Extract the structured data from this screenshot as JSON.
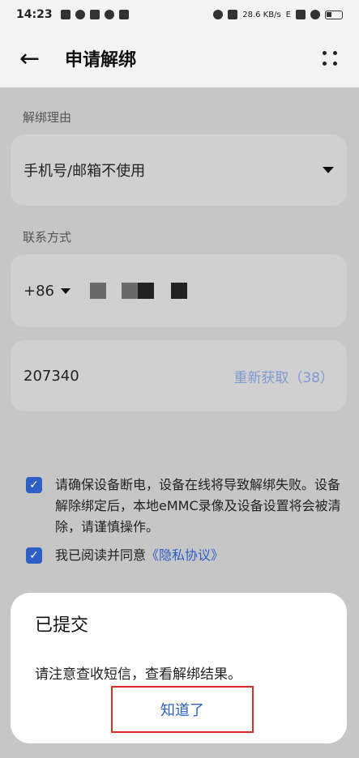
{
  "status_bar": {
    "time": "14:23",
    "net_speed": "28.6 KB/s",
    "network_label": "E"
  },
  "app_bar": {
    "back_symbol": "←",
    "title": "申请解绑"
  },
  "form": {
    "reason_label": "解绑理由",
    "reason_value": "手机号/邮箱不使用",
    "contact_label": "联系方式",
    "country_code": "+86",
    "verification_code": "207340",
    "refetch_label": "重新获取（38）"
  },
  "checks": {
    "warning_text": "请确保设备断电，设备在线将导致解绑失败。设备解除绑定后，本地eMMC录像及设备设置将会被清除，请谨慎操作。",
    "agree_text": "我已阅读并同意",
    "privacy_link": "《隐私协议》",
    "check_mark": "✓"
  },
  "dialog": {
    "title": "已提交",
    "message": "请注意查收短信，查看解绑结果。",
    "confirm_label": "知道了"
  }
}
